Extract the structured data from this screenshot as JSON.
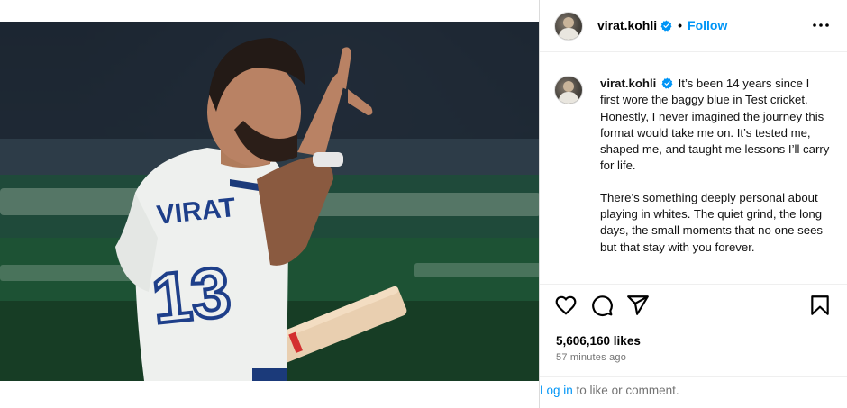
{
  "post": {
    "image_alt": "Virat Kohli in white Test kit number 13 raising his hand while holding a bat",
    "jersey_name": "VIRAT",
    "jersey_number": "13"
  },
  "header": {
    "username": "virat.kohli",
    "separator": "•",
    "follow_label": "Follow",
    "more_icon": "more-options-icon"
  },
  "caption": {
    "username": "virat.kohli",
    "paragraph_1": "It’s been 14 years since I first wore the baggy blue in Test cricket. Honestly, I never imagined the journey this format would take me on. It’s tested me, shaped me, and taught me lessons I’ll carry for life.",
    "paragraph_2": "There’s something deeply personal about playing in whites. The quiet grind, the long days, the small moments that no one sees but that stay with you forever."
  },
  "actions": {
    "like_icon": "heart-icon",
    "comment_icon": "comment-icon",
    "share_icon": "share-icon",
    "save_icon": "bookmark-icon"
  },
  "stats": {
    "likes": "5,606,160 likes",
    "time_ago": "57 minutes ago"
  },
  "footer": {
    "login_label": "Log in",
    "login_suffix": " to like or comment."
  },
  "colors": {
    "accent": "#0095f6",
    "verified": "#0095f6",
    "muted": "#737373",
    "border": "#dbdbdb"
  }
}
